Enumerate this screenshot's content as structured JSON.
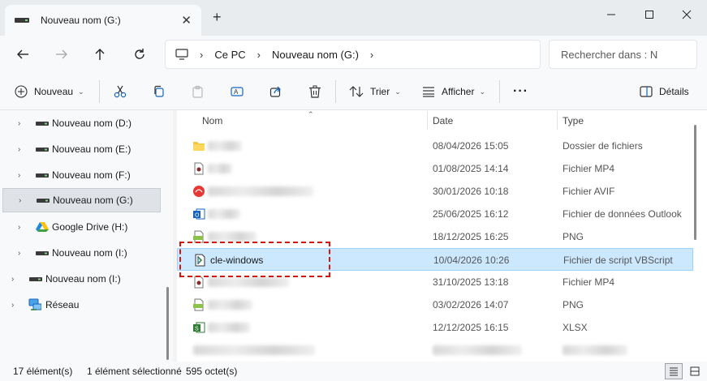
{
  "window": {
    "tab_title": "Nouveau nom (G:)",
    "tab_close": "✕",
    "new_tab": "+",
    "minimize": "—",
    "maximize": "☐",
    "close": "✕"
  },
  "nav": {
    "breadcrumb": [
      "Ce PC",
      "Nouveau nom (G:)"
    ],
    "search_placeholder": "Rechercher dans : N"
  },
  "toolbar": {
    "new_label": "Nouveau",
    "sort_label": "Trier",
    "view_label": "Afficher",
    "more_label": "···",
    "details_label": "Détails"
  },
  "sidebar": {
    "items": [
      {
        "label": "Nouveau nom (D:)",
        "icon": "drive-icon"
      },
      {
        "label": "Nouveau nom (E:)",
        "icon": "drive-icon"
      },
      {
        "label": "Nouveau nom (F:)",
        "icon": "drive-icon"
      },
      {
        "label": "Nouveau nom (G:)",
        "icon": "drive-icon",
        "selected": true
      },
      {
        "label": "Google Drive (H:)",
        "icon": "google-drive-icon"
      },
      {
        "label": "Nouveau nom (I:)",
        "icon": "drive-icon"
      },
      {
        "label": "Nouveau nom (I:)",
        "icon": "drive-icon"
      },
      {
        "label": "Réseau",
        "icon": "network-icon"
      }
    ]
  },
  "list": {
    "columns": {
      "name": "Nom",
      "date": "Date",
      "type": "Type"
    },
    "rows": [
      {
        "name": "",
        "date": "08/04/2026 15:05",
        "type": "Dossier de fichiers",
        "icon": "folder-icon"
      },
      {
        "name": "",
        "date": "01/08/2025 14:14",
        "type": "Fichier MP4",
        "icon": "video-file-icon"
      },
      {
        "name": "",
        "date": "30/01/2026 10:18",
        "type": "Fichier AVIF",
        "icon": "avif-file-icon"
      },
      {
        "name": "",
        "date": "25/06/2025 16:12",
        "type": "Fichier de données Outlook",
        "icon": "outlook-file-icon"
      },
      {
        "name": "",
        "date": "18/12/2025 16:25",
        "type": "PNG",
        "icon": "png-file-icon"
      },
      {
        "name": "cle-windows",
        "date": "10/04/2026 10:26",
        "type": "Fichier de script VBScript",
        "icon": "vbscript-file-icon",
        "selected": true
      },
      {
        "name": "",
        "date": "31/10/2025 13:18",
        "type": "Fichier MP4",
        "icon": "video-file-icon"
      },
      {
        "name": "",
        "date": "03/02/2026 14:07",
        "type": "PNG",
        "icon": "png-file-icon"
      },
      {
        "name": "",
        "date": "12/12/2025 16:15",
        "type": "XLSX",
        "icon": "xlsx-file-icon"
      }
    ]
  },
  "status": {
    "count": "17 élément(s)",
    "selection": "1 élément sélectionné",
    "size": "595 octet(s)"
  }
}
